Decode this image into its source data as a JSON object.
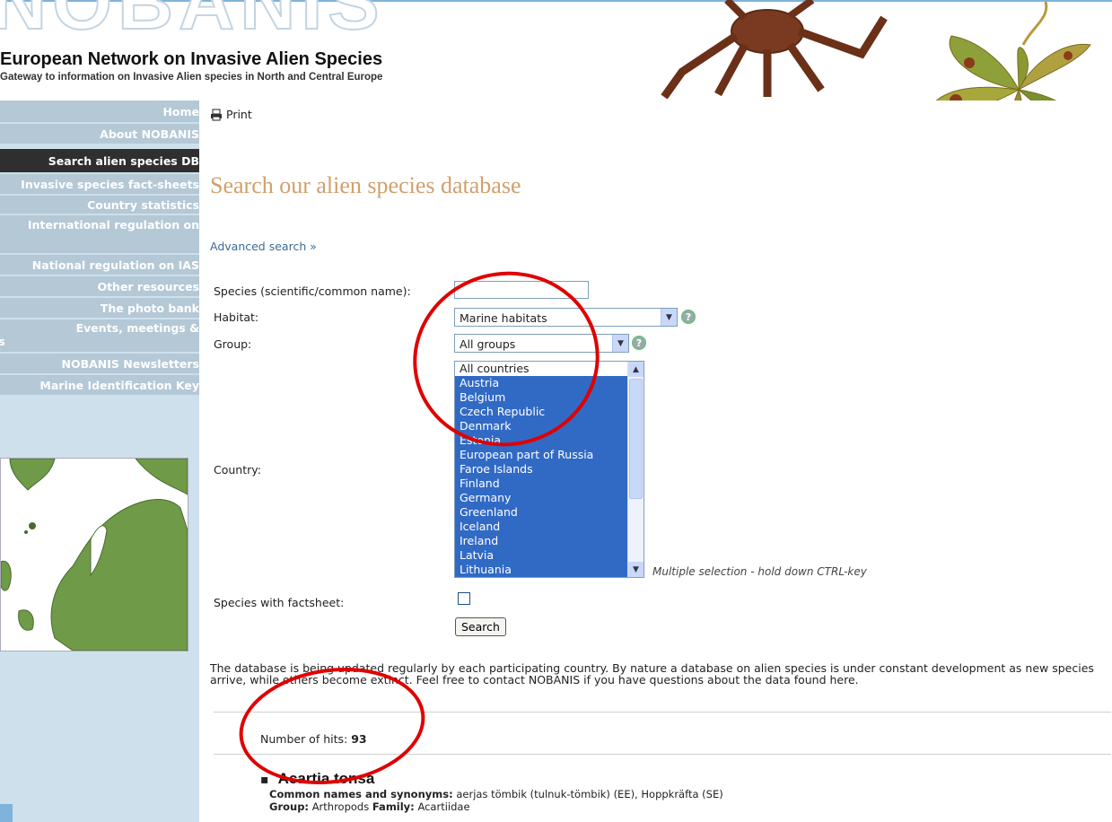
{
  "header": {
    "logo": "NOBANIS",
    "title": "European Network on Invasive Alien Species",
    "subtitle": "Gateway to information on Invasive Alien species in North and Central Europe"
  },
  "sidebar": {
    "items": [
      {
        "label": "Home",
        "active": false
      },
      {
        "label": "About NOBANIS",
        "active": false
      },
      {
        "label": "Search alien species DB",
        "active": true
      },
      {
        "label": "Invasive species fact-sheets",
        "active": false
      },
      {
        "label": "Country statistics",
        "active": false
      },
      {
        "label": "International regulation on",
        "active": false
      },
      {
        "label": "National regulation on IAS",
        "active": false
      },
      {
        "label": "Other resources",
        "active": false
      },
      {
        "label": "The photo bank",
        "active": false
      },
      {
        "label": "Events, meetings &",
        "label2": "conferences",
        "active": false
      },
      {
        "label": "NOBANIS Newsletters",
        "active": false
      },
      {
        "label": "Marine Identification Key",
        "active": false
      }
    ]
  },
  "main": {
    "print_label": "Print",
    "page_title": "Search our alien species database",
    "advanced_search": "Advanced search »",
    "form": {
      "species_label": "Species (scientific/common name):",
      "species_value": "",
      "habitat_label": "Habitat:",
      "habitat_value": "Marine habitats",
      "group_label": "Group:",
      "group_value": "All groups",
      "country_label": "Country:",
      "countries": [
        {
          "name": "All countries",
          "selected": false
        },
        {
          "name": "Austria",
          "selected": true
        },
        {
          "name": "Belgium",
          "selected": true
        },
        {
          "name": "Czech Republic",
          "selected": true
        },
        {
          "name": "Denmark",
          "selected": true
        },
        {
          "name": "Estonia",
          "selected": true
        },
        {
          "name": "European part of Russia",
          "selected": true
        },
        {
          "name": "Faroe Islands",
          "selected": true
        },
        {
          "name": "Finland",
          "selected": true
        },
        {
          "name": "Germany",
          "selected": true
        },
        {
          "name": "Greenland",
          "selected": true
        },
        {
          "name": "Iceland",
          "selected": true
        },
        {
          "name": "Ireland",
          "selected": true
        },
        {
          "name": "Latvia",
          "selected": true
        },
        {
          "name": "Lithuania",
          "selected": true
        }
      ],
      "multi_hint": "Multiple selection - hold down CTRL-key",
      "factsheet_label": "Species with factsheet:",
      "factsheet_checked": false,
      "search_button": "Search"
    },
    "disclaimer": "The database is being updated regularly by each participating country. By nature a database on alien species is under constant development as new species arrive, while others become extinct. Feel free to contact NOBANIS if you have questions about the data found here.",
    "hits_label": "Number of hits:",
    "hits_count": "93",
    "result": {
      "name": "Acartia tonsa",
      "common_label": "Common names and synonyms:",
      "common_value": "aerjas tömbik (tulnuk-tömbik) (EE), Hoppkräfta (SE)",
      "group_label": "Group:",
      "group_value": "Arthropods",
      "family_label": "Family:",
      "family_value": "Acartiidae"
    }
  },
  "colors": {
    "accent_title": "#d0a06c",
    "link": "#3b6b96",
    "sidebar_bg": "#cee0ec",
    "nav_bg": "#b4c8d6",
    "nav_active": "#2f2f2f",
    "selection": "#316ac5",
    "annotation": "#e00000"
  }
}
